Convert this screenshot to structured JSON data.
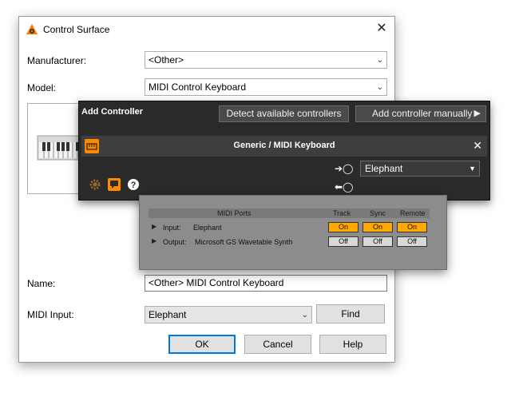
{
  "dialog": {
    "title": "Control Surface",
    "manufacturer_label": "Manufacturer:",
    "manufacturer_value": "<Other>",
    "model_label": "Model:",
    "model_value": "MIDI Control Keyboard",
    "name_label": "Name:",
    "name_value": "<Other> MIDI Control Keyboard",
    "midi_input_label": "MIDI Input:",
    "midi_input_value": "Elephant",
    "find_label": "Find",
    "ok_label": "OK",
    "cancel_label": "Cancel",
    "help_label": "Help"
  },
  "add_controller": {
    "title": "Add Controller",
    "detect_label": "Detect available controllers",
    "manual_label": "Add controller manually",
    "device_name": "Generic / MIDI Keyboard",
    "input_port_value": "Elephant"
  },
  "midi_ports": {
    "headers": {
      "ports": "MIDI Ports",
      "track": "Track",
      "sync": "Sync",
      "remote": "Remote"
    },
    "rows": [
      {
        "direction": "Input:",
        "port": "Elephant",
        "track": "On",
        "sync": "On",
        "remote": "On"
      },
      {
        "direction": "Output:",
        "port": "Microsoft GS Wavetable Synth",
        "track": "Off",
        "sync": "Off",
        "remote": "Off"
      }
    ]
  },
  "colors": {
    "accent": "#ff8a00",
    "on": "#ffa800",
    "default_button_border": "#0078d7"
  },
  "icons": [
    "reason-logo-icon",
    "close-icon",
    "chevron-down-icon",
    "keyboard-icon",
    "gear-icon",
    "chat-icon",
    "help-icon",
    "midi-in-icon",
    "midi-out-icon",
    "triangle-right-icon"
  ]
}
